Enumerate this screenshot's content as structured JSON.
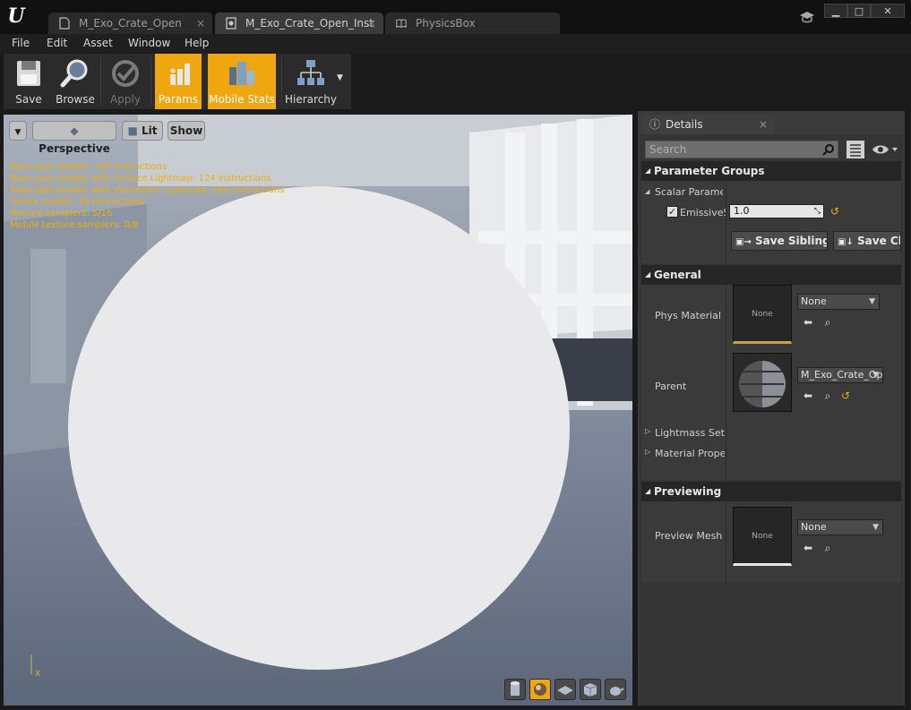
{
  "tabs": [
    {
      "label": "M_Exo_Crate_Open",
      "active": false
    },
    {
      "label": "M_Exo_Crate_Open_Inst",
      "active": true
    },
    {
      "label": "PhysicsBox",
      "active": false
    }
  ],
  "menu": [
    "File",
    "Edit",
    "Asset",
    "Window",
    "Help"
  ],
  "toolbar": {
    "save": "Save",
    "browse": "Browse",
    "apply": "Apply",
    "params": "Params",
    "mobile_stats": "Mobile Stats",
    "hierarchy": "Hierarchy"
  },
  "viewport": {
    "view_mode": "Perspective",
    "lighting": "Lit",
    "show": "Show",
    "stats": [
      "Base pass shader: 107 instructions",
      "Base pass shader with Surface Lightmap: 124 instructions",
      "Base pass shader with Volumetric Lightmap: 180 instructions",
      "Vertex shader: 38 instructions",
      "Texture samplers: 5/16",
      "Mobile texture samplers: 0/8"
    ],
    "axis_label": "X"
  },
  "details": {
    "tab_title": "Details",
    "search_placeholder": "Search",
    "parameter_groups": "Parameter Groups",
    "scalar_group": "Scalar Parame",
    "emissive_label": "EmissiveS",
    "emissive_value": "1.0",
    "save_sibling": "Save Sibling",
    "save_child": "Save Ch",
    "general": "General",
    "phys_material": "Phys Material",
    "phys_material_thumb": "None",
    "phys_material_value": "None",
    "parent": "Parent",
    "parent_value": "M_Exo_Crate_Op",
    "lightmass": "Lightmass Setti",
    "material_props": "Material Prope",
    "previewing": "Previewing",
    "preview_mesh": "Preview Mesh",
    "preview_mesh_thumb": "None",
    "preview_mesh_value": "None"
  },
  "colors": {
    "accent": "#f0a70f",
    "stats_text": "#f0b000"
  }
}
